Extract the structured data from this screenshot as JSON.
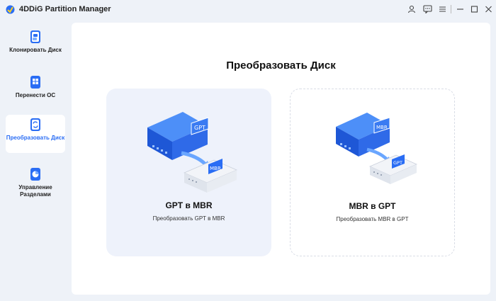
{
  "app": {
    "title": "4DDiG Partition Manager"
  },
  "sidebar": {
    "items": [
      {
        "label": "Клонировать Диск",
        "active": false
      },
      {
        "label": "Перенести ОС",
        "active": false
      },
      {
        "label": "Преобразовать Диск",
        "active": true
      },
      {
        "label_line1": "Управление",
        "label_line2": "Разделами",
        "active": false
      }
    ]
  },
  "main": {
    "title": "Преобразовать Диск",
    "options": [
      {
        "title": "GPT в MBR",
        "subtitle": "Преобразовать GPT в MBR",
        "source_badge": "GPT",
        "target_badge": "MBR"
      },
      {
        "title": "MBR в GPT",
        "subtitle": "Преобразовать MBR в GPT",
        "source_badge": "MBR",
        "target_badge": "GPT"
      }
    ]
  },
  "colors": {
    "accent": "#2a6df4",
    "sidebar_bg": "#eef2f8",
    "card_selected_bg": "#eef2fb"
  },
  "icons": [
    "user-icon",
    "feedback-icon",
    "menu-icon",
    "minimize-icon",
    "maximize-icon",
    "close-icon"
  ]
}
